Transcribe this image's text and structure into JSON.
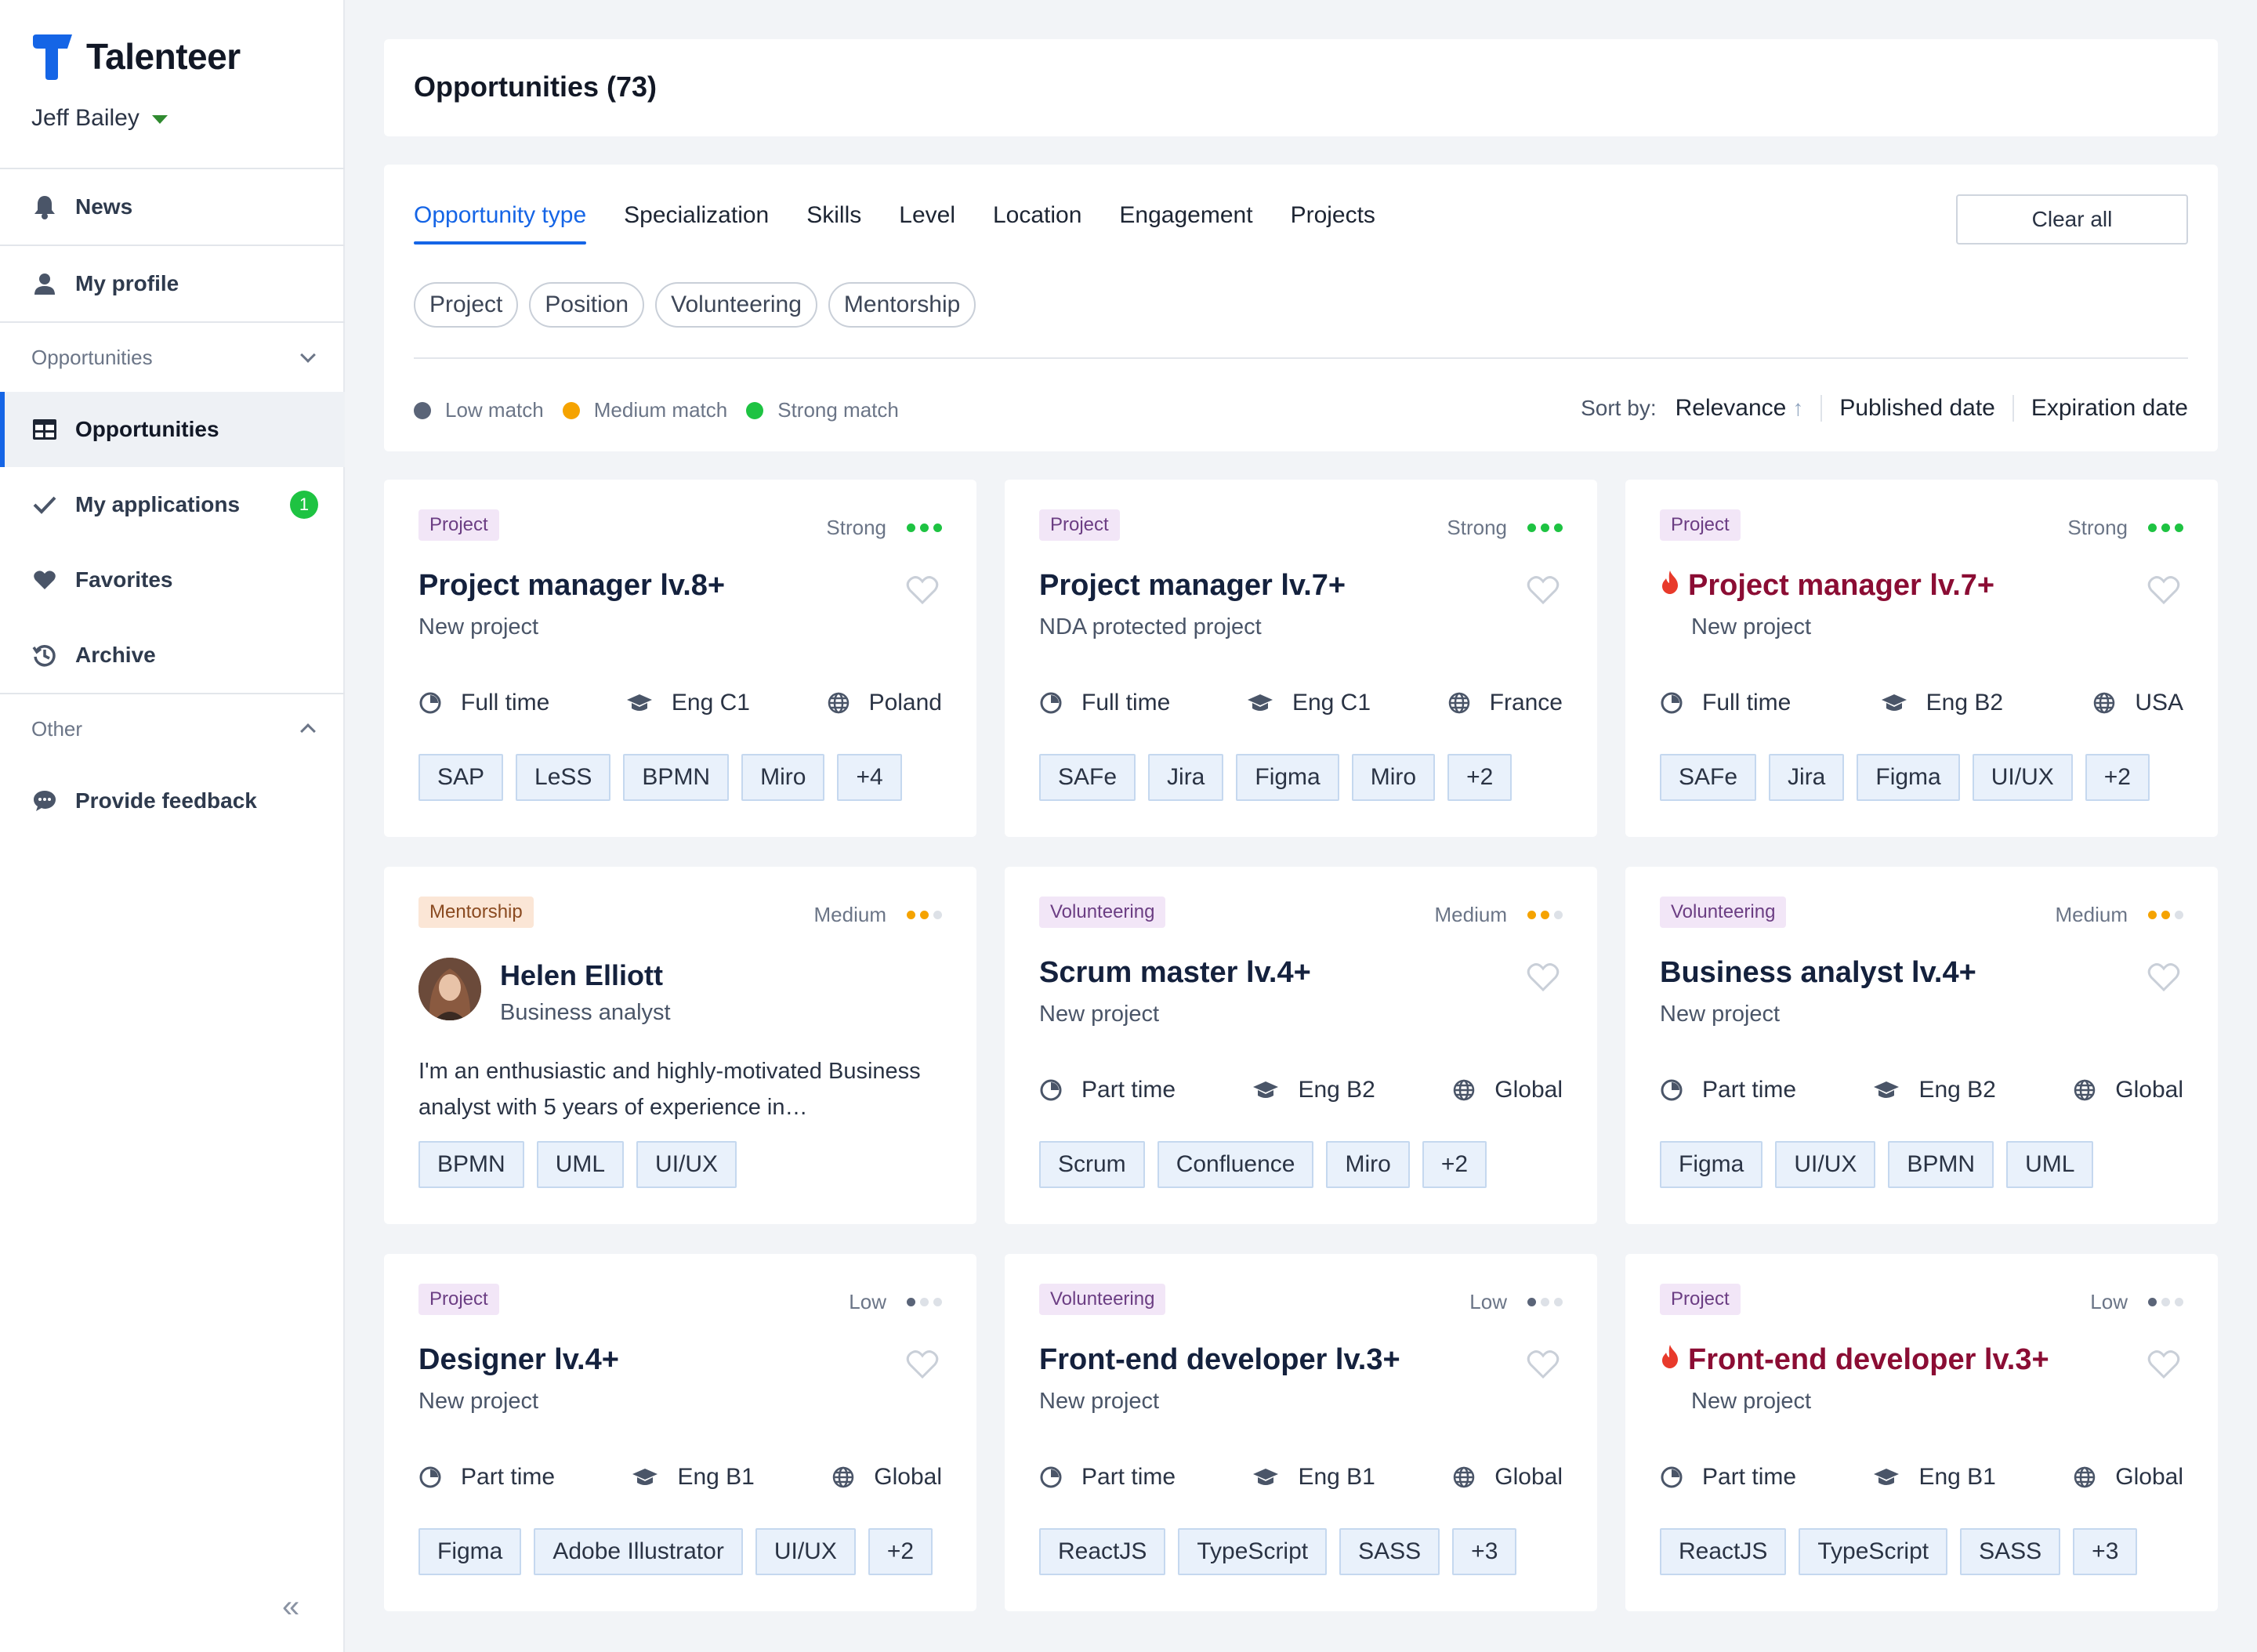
{
  "app": {
    "name": "Talenteer",
    "user_name": "Jeff Bailey"
  },
  "sidebar": {
    "news": "News",
    "my_profile": "My profile",
    "opportunities_group": "Opportunities",
    "opportunities": "Opportunities",
    "my_applications": "My applications",
    "applications_count": "1",
    "favorites": "Favorites",
    "archive": "Archive",
    "other_group": "Other",
    "feedback": "Provide feedback"
  },
  "header": {
    "title": "Opportunities (73)"
  },
  "filters": {
    "tabs": [
      "Opportunity type",
      "Specialization",
      "Skills",
      "Level",
      "Location",
      "Engagement",
      "Projects"
    ],
    "active_tab": "Opportunity type",
    "clear_all": "Clear all",
    "chips": [
      "Project",
      "Position",
      "Volunteering",
      "Mentorship"
    ]
  },
  "legend": {
    "low": "Low match",
    "medium": "Medium match",
    "strong": "Strong match"
  },
  "sort": {
    "label": "Sort by:",
    "relevance": "Relevance",
    "published": "Published date",
    "expiration": "Expiration date"
  },
  "colors": {
    "accent": "#1565e6",
    "low": "#5a6478",
    "medium": "#f5a300",
    "strong": "#1ec342",
    "hot": "#8b0d34",
    "badge": "#1ec342"
  },
  "cards": [
    {
      "type": "Project",
      "match": "Strong",
      "title": "Project manager lv.8+",
      "hot": false,
      "subtitle": "New project",
      "engagement": "Full time",
      "english": "Eng C1",
      "location": "Poland",
      "skills": [
        "SAP",
        "LeSS",
        "BPMN",
        "Miro",
        "+4"
      ]
    },
    {
      "type": "Project",
      "match": "Strong",
      "title": "Project manager lv.7+",
      "hot": false,
      "subtitle": "NDA protected project",
      "engagement": "Full time",
      "english": "Eng C1",
      "location": "France",
      "skills": [
        "SAFe",
        "Jira",
        "Figma",
        "Miro",
        "+2"
      ]
    },
    {
      "type": "Project",
      "match": "Strong",
      "title": "Project manager lv.7+",
      "hot": true,
      "subtitle": "New project",
      "engagement": "Full time",
      "english": "Eng B2",
      "location": "USA",
      "skills": [
        "SAFe",
        "Jira",
        "Figma",
        "UI/UX",
        "+2"
      ]
    },
    {
      "type": "Mentorship",
      "match": "Medium",
      "mentor_name": "Helen Elliott",
      "mentor_role": "Business analyst",
      "bio": "I'm an enthusiastic and highly-motivated Business analyst with 5 years of experience in…",
      "skills": [
        "BPMN",
        "UML",
        "UI/UX"
      ]
    },
    {
      "type": "Volunteering",
      "match": "Medium",
      "title": "Scrum master lv.4+",
      "hot": false,
      "subtitle": "New project",
      "engagement": "Part time",
      "english": "Eng B2",
      "location": "Global",
      "skills": [
        "Scrum",
        "Confluence",
        "Miro",
        "+2"
      ]
    },
    {
      "type": "Volunteering",
      "match": "Medium",
      "title": "Business analyst lv.4+",
      "hot": false,
      "subtitle": "New project",
      "engagement": "Part time",
      "english": "Eng B2",
      "location": "Global",
      "skills": [
        "Figma",
        "UI/UX",
        "BPMN",
        "UML"
      ]
    },
    {
      "type": "Project",
      "match": "Low",
      "title": "Designer lv.4+",
      "hot": false,
      "subtitle": "New project",
      "engagement": "Part time",
      "english": "Eng B1",
      "location": "Global",
      "skills": [
        "Figma",
        "Adobe Illustrator",
        "UI/UX",
        "+2"
      ]
    },
    {
      "type": "Volunteering",
      "match": "Low",
      "title": "Front-end developer lv.3+",
      "hot": false,
      "subtitle": "New project",
      "engagement": "Part time",
      "english": "Eng B1",
      "location": "Global",
      "skills": [
        "ReactJS",
        "TypeScript",
        "SASS",
        "+3"
      ]
    },
    {
      "type": "Project",
      "match": "Low",
      "title": "Front-end developer lv.3+",
      "hot": true,
      "subtitle": "New project",
      "engagement": "Part time",
      "english": "Eng B1",
      "location": "Global",
      "skills": [
        "ReactJS",
        "TypeScript",
        "SASS",
        "+3"
      ]
    }
  ]
}
